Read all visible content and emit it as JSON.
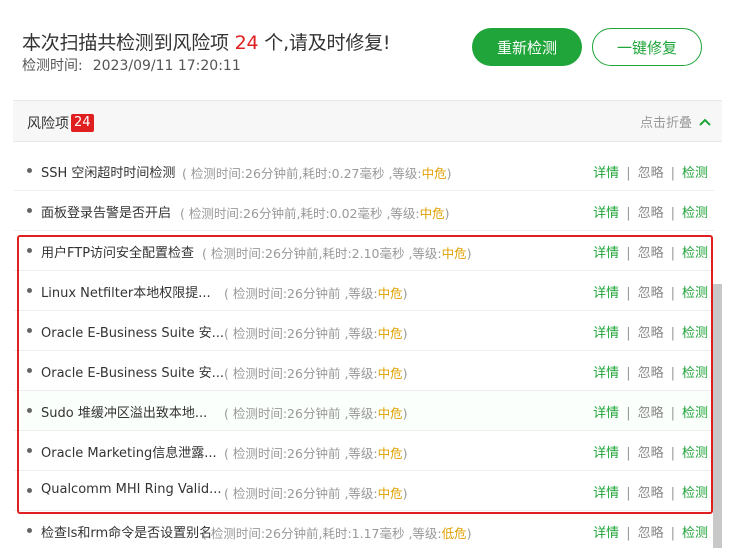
{
  "header": {
    "headline_prefix": "本次扫描共检测到风险项",
    "risk_count": "24",
    "headline_suffix": "个,请及时修复!",
    "time_label": "检测时间:",
    "time_value": "2023/09/11 17:20:11",
    "rescan_label": "重新检测",
    "fix_all_label": "一键修复"
  },
  "section": {
    "title": "风险项",
    "badge": "24",
    "collapse_label": "点击折叠"
  },
  "actions": {
    "details": "详情",
    "ignore": "忽略",
    "check": "检测",
    "sep": "|"
  },
  "risks": [
    {
      "name": "SSH 空闲超时时间检测",
      "meta_prefix": "( 检测时间:26分钟前,耗时:0.27毫秒 ,等级:",
      "level": "中危",
      "meta_suffix": ")"
    },
    {
      "name": "面板登录告警是否开启",
      "meta_prefix": "( 检测时间:26分钟前,耗时:0.02毫秒 ,等级:",
      "level": "中危",
      "meta_suffix": ")"
    },
    {
      "name": "用户FTP访问安全配置检查",
      "meta_prefix": "( 检测时间:26分钟前,耗时:2.10毫秒 ,等级:",
      "level": "中危",
      "meta_suffix": ")"
    },
    {
      "name": "Linux Netfilter本地权限提...",
      "meta_prefix": "( 检测时间:26分钟前 ,等级:",
      "level": "中危",
      "meta_suffix": ")"
    },
    {
      "name": "Oracle E-Business Suite 安...",
      "meta_prefix": "( 检测时间:26分钟前 ,等级:",
      "level": "中危",
      "meta_suffix": ")"
    },
    {
      "name": "Oracle E-Business Suite 安...",
      "meta_prefix": "( 检测时间:26分钟前 ,等级:",
      "level": "中危",
      "meta_suffix": ")"
    },
    {
      "name": "Sudo 堆缓冲区溢出致本地...",
      "meta_prefix": "( 检测时间:26分钟前 ,等级:",
      "level": "中危",
      "meta_suffix": ")"
    },
    {
      "name": "Oracle Marketing信息泄露...",
      "meta_prefix": "( 检测时间:26分钟前 ,等级:",
      "level": "中危",
      "meta_suffix": ")"
    },
    {
      "name": "Qualcomm MHI Ring Valid...",
      "meta_prefix": "( 检测时间:26分钟前 ,等级:",
      "level": "中危",
      "meta_suffix": ")"
    },
    {
      "name": "检查ls和rm命令是否设置别名",
      "meta_prefix": "( 检测时间:26分钟前,耗时:1.17毫秒 ,等级:",
      "level": "低危",
      "meta_suffix": ")"
    }
  ],
  "colors": {
    "accent": "#20a53a",
    "danger": "#e02020",
    "warning": "#e0a000"
  }
}
